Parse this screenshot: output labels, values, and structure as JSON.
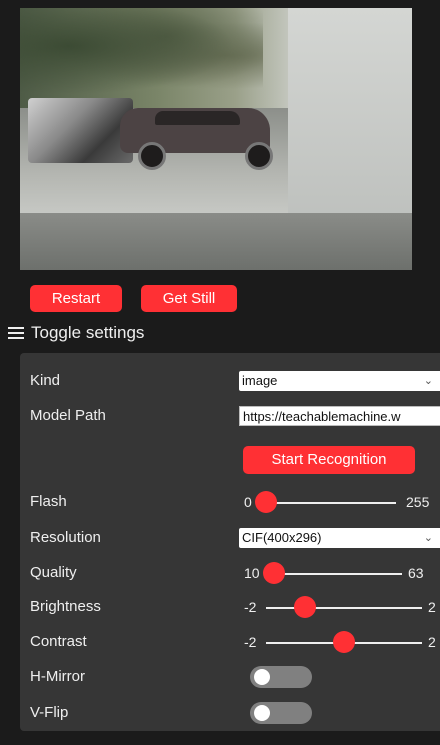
{
  "controls": {
    "restart_label": "Restart",
    "get_still_label": "Get Still",
    "toggle_settings_label": "Toggle settings"
  },
  "settings": {
    "kind": {
      "label": "Kind",
      "value": "image"
    },
    "model_path": {
      "label": "Model Path",
      "value": "https://teachablemachine.w"
    },
    "start_recognition_label": "Start Recognition",
    "flash": {
      "label": "Flash",
      "min": "0",
      "max": "255",
      "value": 0
    },
    "resolution": {
      "label": "Resolution",
      "value": "CIF(400x296)"
    },
    "quality": {
      "label": "Quality",
      "min": "10",
      "max": "63",
      "value": 10
    },
    "brightness": {
      "label": "Brightness",
      "min": "-2",
      "max": "2",
      "value": -1
    },
    "contrast": {
      "label": "Contrast",
      "min": "-2",
      "max": "2",
      "value": 0
    },
    "hmirror": {
      "label": "H-Mirror",
      "on": false
    },
    "vflip": {
      "label": "V-Flip",
      "on": false
    }
  },
  "colors": {
    "accent": "#ff3034",
    "panel": "#363636",
    "background": "#1b1b1b"
  }
}
